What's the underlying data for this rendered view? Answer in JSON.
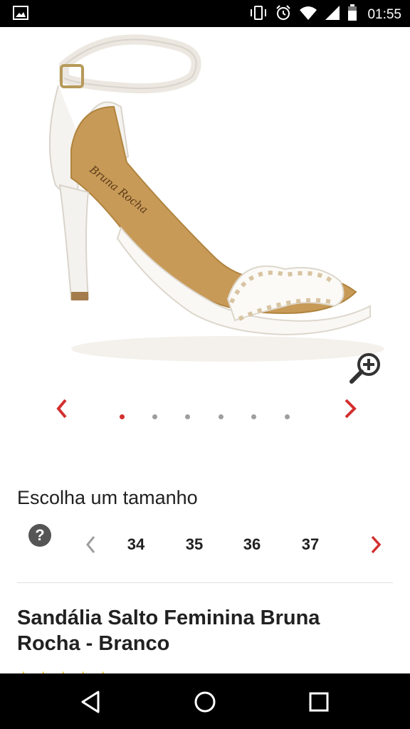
{
  "status_bar": {
    "time": "01:55",
    "icons": [
      "image-icon",
      "vibrate-icon",
      "alarm-icon",
      "wifi-icon",
      "signal-icon",
      "battery-icon"
    ]
  },
  "gallery": {
    "image_subject": "white stiletto ankle-strap sandal",
    "insole_brand_text": "Bruna Rocha",
    "dot_count": 6,
    "active_dot": 0
  },
  "size_chooser": {
    "title": "Escolha um tamanho",
    "help_label": "?",
    "sizes": [
      "34",
      "35",
      "36",
      "37"
    ]
  },
  "product": {
    "title": "Sandália Salto Feminina Bruna Rocha - Branco"
  },
  "colors": {
    "accent": "#d32f2f",
    "inactive_dot": "#9e9e9e",
    "text": "#212121"
  }
}
